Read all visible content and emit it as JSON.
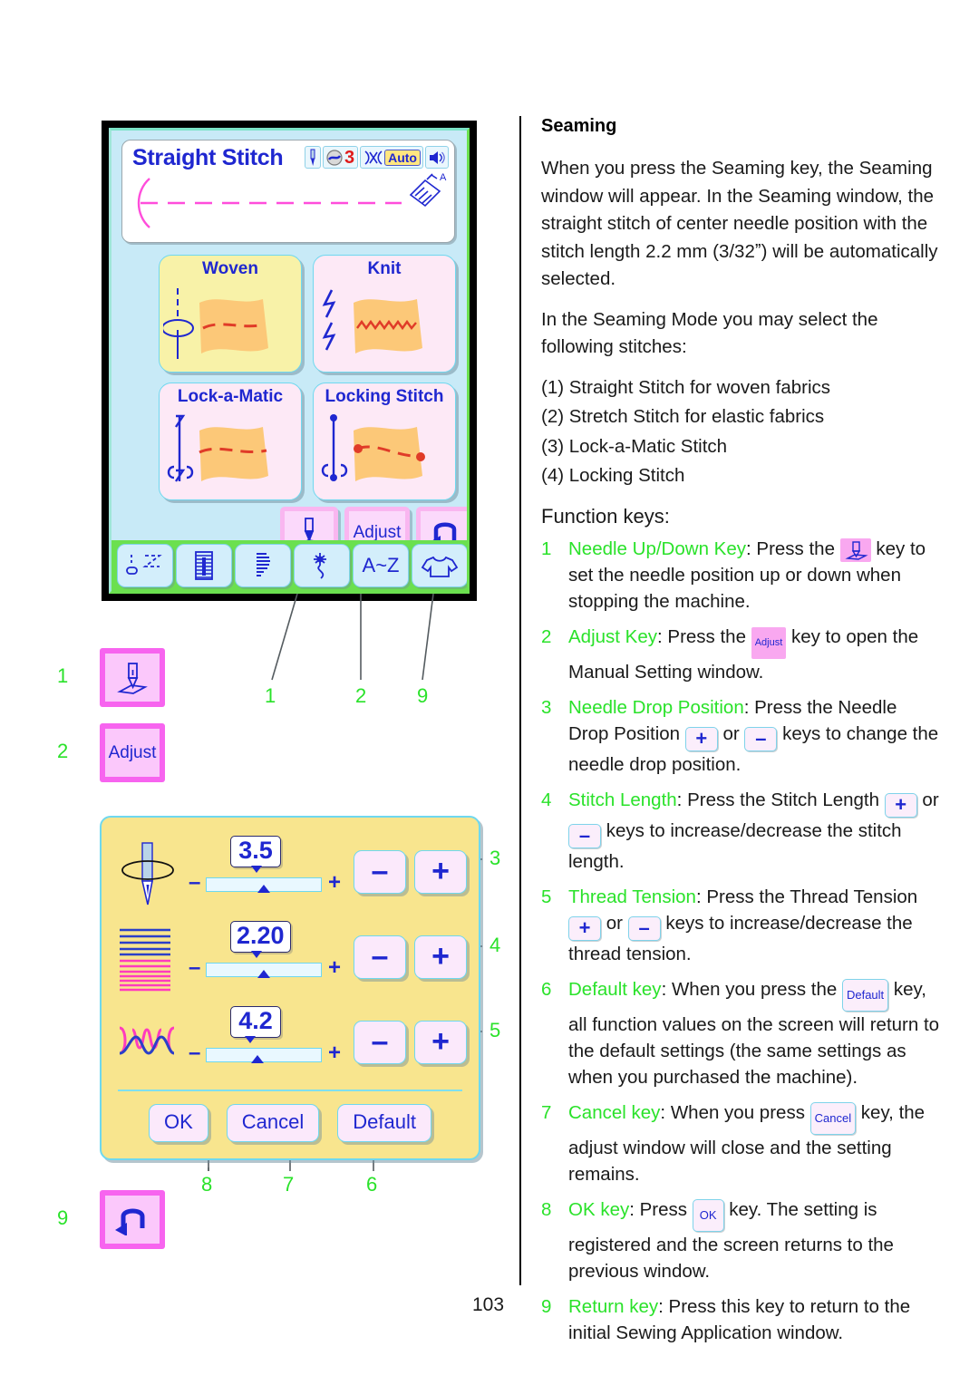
{
  "page": {
    "number": "103"
  },
  "lcd": {
    "title": "Straight Stitch",
    "status": {
      "needle_icon": "needle-icon",
      "presser_foot_icon": "presser-foot-icon",
      "presser_foot_value": "3",
      "tension_icon": "thread-tension-icon",
      "tension_value": "Auto",
      "sound_icon": "speaker-icon"
    },
    "stitch_buttons": [
      {
        "label": "Woven",
        "icon": "woven-fabric-straight-stitch-icon"
      },
      {
        "label": "Knit",
        "icon": "knit-fabric-stretch-stitch-icon"
      },
      {
        "label": "Lock-a-Matic",
        "icon": "lock-a-matic-stitch-icon"
      },
      {
        "label": "Locking Stitch",
        "icon": "locking-stitch-icon"
      }
    ],
    "function_keys": [
      {
        "name": "needle-up-down-key",
        "label": ""
      },
      {
        "name": "adjust-key",
        "label": "Adjust"
      },
      {
        "name": "return-key",
        "label": ""
      }
    ],
    "tabs": [
      {
        "name": "tab-utility-stitch",
        "label": ""
      },
      {
        "name": "tab-buttonhole",
        "label": ""
      },
      {
        "name": "tab-satin-stitch",
        "label": ""
      },
      {
        "name": "tab-applique",
        "label": ""
      },
      {
        "name": "tab-monogram",
        "label": "A~Z"
      },
      {
        "name": "tab-sewing-application",
        "label": ""
      }
    ]
  },
  "legend": {
    "needle_callout": "1",
    "adjust_callout": "2",
    "adjust_label": "Adjust",
    "return_callout": "9",
    "screen_callouts": {
      "needle": "1",
      "adjust": "2",
      "return": "9"
    }
  },
  "adjust_window": {
    "rows": [
      {
        "icon": "needle-drop-position-icon",
        "value": "3.5",
        "minus_small": "–",
        "plus_small": "+",
        "minus_big": "–",
        "plus_big": "+",
        "callout": "3"
      },
      {
        "icon": "stitch-length-icon",
        "value": "2.20",
        "minus_small": "–",
        "plus_small": "+",
        "minus_big": "–",
        "plus_big": "+",
        "callout": "4"
      },
      {
        "icon": "thread-tension-icon",
        "value": "4.2",
        "minus_small": "–",
        "plus_small": "+",
        "minus_big": "–",
        "plus_big": "+",
        "callout": "5"
      }
    ],
    "buttons": [
      {
        "label": "OK",
        "callout": "8"
      },
      {
        "label": "Cancel",
        "callout": "7"
      },
      {
        "label": "Default",
        "callout": "6"
      }
    ]
  },
  "text": {
    "heading": "Seaming",
    "paragraph1": "When you press the Seaming key, the Seaming window will appear. In the Seaming window, the straight stitch of center needle position with the stitch length 2.2 mm (3/32ˮ) will be automatically selected.",
    "paragraph2": "In the Seaming Mode you may select the following stitches:",
    "stitch_list": [
      "(1) Straight Stitch for woven fabrics",
      "(2) Stretch Stitch for elastic fabrics",
      "(3) Lock-a-Matic Stitch",
      "(4) Locking Stitch"
    ],
    "function_keys_title": "Function keys:",
    "function_keys": [
      {
        "num": "1",
        "name": "Needle Up/Down Key",
        "body_a": ": Press the ",
        "chip": "needle-up-down-icon",
        "body_b": " key to set the needle position up or down when stopping the machine."
      },
      {
        "num": "2",
        "name": "Adjust Key",
        "body_a": ": Press the ",
        "chip": "Adjust",
        "body_b": " key to open the Manual Setting window."
      },
      {
        "num": "3",
        "name": "Needle Drop Position",
        "body_a": ": Press the Needle Drop Position ",
        "chip_plus": "+",
        "mid": " or ",
        "chip_minus": "–",
        "body_b": " keys to change the needle drop position."
      },
      {
        "num": "4",
        "name": "Stitch Length",
        "body_a": ": Press the Stitch Length ",
        "chip_plus": "+",
        "mid": " or ",
        "chip_minus": "–",
        "body_b": " keys to increase/decrease the stitch length."
      },
      {
        "num": "5",
        "name": "Thread Tension",
        "body_a": ": Press the Thread Tension ",
        "chip_plus": "+",
        "mid": " or ",
        "chip_minus": "–",
        "body_b": " keys to increase/decrease the thread tension."
      },
      {
        "num": "6",
        "name": "Default key",
        "body_a": ": When you press the ",
        "chip": "Default",
        "body_b": " key, all function values on the screen will return to the default settings (the same settings as when you purchased the machine)."
      },
      {
        "num": "7",
        "name": "Cancel key",
        "body_a": ": When you press ",
        "chip": "Cancel",
        "body_b": " key, the adjust window will close and the setting remains."
      },
      {
        "num": "8",
        "name": "OK key",
        "body_a": ": Press ",
        "chip": "OK",
        "body_b": " key. The setting is registered and the screen returns to the previous window."
      },
      {
        "num": "9",
        "name": "Return key",
        "body_a": ": Press this key to return to the initial Sewing Application window.",
        "chip": "",
        "body_b": ""
      }
    ]
  },
  "colors": {
    "lcd_background": "#c8eaf7",
    "title_blue": "#1f27d0",
    "callout_green": "#2ae22a",
    "key_pink": "#f9b6f0",
    "adjust_window_yellow": "#f8e58e",
    "tab_strip_green": "#6be04f",
    "fabric_orange": "#fcc878",
    "stitch_red": "#e03b28",
    "stitch_magenta": "#ff4ddb"
  }
}
